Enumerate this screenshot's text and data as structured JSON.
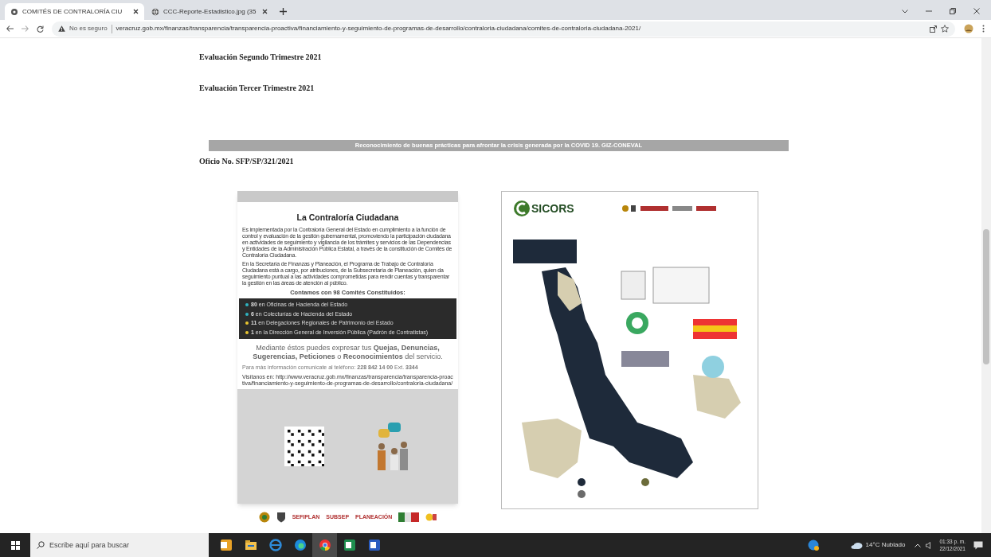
{
  "browser": {
    "tabs": [
      {
        "title": "COMITÉS DE CONTRALORÍA CIU",
        "selected": true
      },
      {
        "title": "CCC-Reporte-Estadistico.jpg (35",
        "selected": false
      }
    ],
    "security_label": "No es seguro",
    "url": "veracruz.gob.mx/finanzas/transparencia/transparencia-proactiva/financiamiento-y-seguimiento-de-programas-de-desarrollo/contraloria-ciudadana/comites-de-contraloria-ciudadana-2021/"
  },
  "page": {
    "headings": [
      "Evaluación Segundo Trimestre 2021",
      "Evaluación Tercer Trimestre 2021"
    ],
    "banner": "Reconocimiento de buenas prácticas para afrontar la crisis generada por la COVID 19. GIZ-CONEVAL",
    "office_number": "Oficio No. SFP/SP/321/2021",
    "poster": {
      "title": "La Contraloría Ciudadana",
      "paragraphs": [
        "Es implementada por la Contraloría General del Estado en cumplimiento a la función de control y evaluación de la gestión gubernamental, promoviendo la participación ciudadana en actividades de seguimiento y vigilancia de los trámites y servicios de las Dependencias y Entidades de la Administración Pública Estatal, a través de la constitución de Comités de Contraloría Ciudadana.",
        "En la Secretaría de Finanzas y Planeación, el Programa de Trabajo de Contraloría Ciudadana está a cargo, por atribuciones, de la Subsecretaría de Planeación, quien da seguimiento puntual a las actividades comprometidas para rendir cuentas y transparentar la gestión en las áreas de atención al público."
      ],
      "committees_heading": "Contamos con 98 Comités Constituidos:",
      "committees": [
        {
          "text": "**80** en Oficinas de Hacienda del Estado",
          "color": "#2fb3c0"
        },
        {
          "text": "**6** en Colecturías de Hacienda del Estado",
          "color": "#2fb3c0"
        },
        {
          "text": "**11** en Delegaciones Regionales de Patrimonio del Estado",
          "color": "#e8c530"
        },
        {
          "text": "**1** en la Dirección General de Inversión Pública (Padrón de Contratistas)",
          "color": "#e8c530"
        }
      ],
      "message": "Mediante éstos puedes expresar tus **Quejas, Denuncias, Sugerencias, Peticiones** o **Reconocimientos** del servicio.",
      "contact": "Para más información comunícate al teléfono: **228 842 14 00** Ext. **3344**",
      "website": "Visítanos en: http://www.veracruz.gob.mx/finanzas/transparencia/transparencia-proactiva/financiamiento-y-seguimiento-de-programas-de-desarrollo/contraloria-ciudadana/",
      "logos": [
        "SEFIPLAN",
        "SUBSEP",
        "PLANEACIÓN"
      ]
    },
    "report": {
      "logo": "SICORS"
    }
  },
  "taskbar": {
    "search": {
      "placeholder": "Escribe aquí para buscar"
    },
    "apps": [
      {
        "kind": "outlook",
        "selected": false
      },
      {
        "kind": "explorer",
        "selected": false
      },
      {
        "kind": "ie",
        "selected": false
      },
      {
        "kind": "edge",
        "selected": false
      },
      {
        "kind": "chrome",
        "selected": true
      },
      {
        "kind": "excel",
        "selected": false
      },
      {
        "kind": "word",
        "selected": false
      }
    ],
    "weather": "14°C Nublado",
    "time": "01:33 p. m.",
    "date": "22/12/2021"
  }
}
